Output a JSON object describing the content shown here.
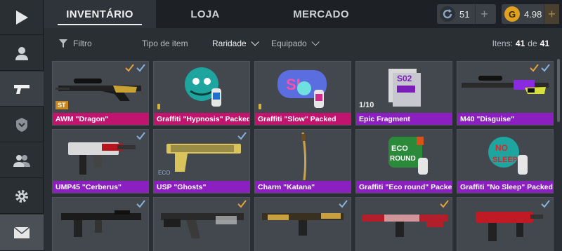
{
  "tabs": {
    "inventory": "INVENTÁRIO",
    "shop": "LOJA",
    "market": "MERCADO"
  },
  "currency": {
    "silver": {
      "value": "51",
      "icon": "refresh-coin-icon",
      "color": "#8aa4c4"
    },
    "gold": {
      "value": "4.98",
      "icon": "gold-coin-icon",
      "color": "#e0a020"
    }
  },
  "filters": {
    "filter": "Filtro",
    "item_type": "Tipo de item",
    "rarity": "Raridade",
    "equipped": "Equipado"
  },
  "items_count": {
    "label": "Itens:",
    "current": "41",
    "separator": "de",
    "total": "41"
  },
  "colors": {
    "pink": "#c0146e",
    "purple": "#7a1fb5",
    "dark_purple": "#8b1fc0",
    "check_orange": "#e3a33a",
    "check_blue": "#8ab0e0"
  },
  "items": [
    {
      "name": "AWM \"Dragon\"",
      "rarity": "pink",
      "badge": "ST",
      "checks": [
        "orange",
        "blue"
      ],
      "art": "sniper"
    },
    {
      "name": "Graffiti \"Hypnosis\" Packed",
      "rarity": "pink",
      "pin": true,
      "checks": [],
      "art": "graffiti-hypnosis"
    },
    {
      "name": "Graffiti \"Slow\" Packed",
      "rarity": "pink",
      "pin": true,
      "checks": [],
      "art": "graffiti-slow"
    },
    {
      "name": "Epic Fragment",
      "rarity": "purple",
      "count": "1/10",
      "checks": [],
      "art": "fragment"
    },
    {
      "name": "M40 \"Disguise\"",
      "rarity": "purple",
      "checks": [
        "orange",
        "blue"
      ],
      "art": "sniper-purple"
    },
    {
      "name": "UMP45 \"Cerberus\"",
      "rarity": "purple",
      "checks": [
        "blue"
      ],
      "art": "smg"
    },
    {
      "name": "USP \"Ghosts\"",
      "rarity": "purple",
      "checks": [
        "blue"
      ],
      "art": "pistol"
    },
    {
      "name": "Charm \"Katana\"",
      "rarity": "purple",
      "checks": [],
      "art": "katana"
    },
    {
      "name": "Graffiti \"Eco round\" Packed",
      "rarity": "purple",
      "checks": [],
      "art": "graffiti-eco"
    },
    {
      "name": "Graffiti \"No Sleep\" Packed",
      "rarity": "purple",
      "checks": [],
      "art": "graffiti-nosleep"
    },
    {
      "name": "",
      "rarity": "none",
      "checks": [
        "blue"
      ],
      "art": "rifle-black"
    },
    {
      "name": "",
      "rarity": "none",
      "checks": [
        "orange"
      ],
      "art": "ak"
    },
    {
      "name": "",
      "rarity": "none",
      "checks": [
        "blue"
      ],
      "art": "m4"
    },
    {
      "name": "",
      "rarity": "none",
      "checks": [
        "orange"
      ],
      "art": "rifle-red"
    },
    {
      "name": "",
      "rarity": "none",
      "checks": [
        "blue"
      ],
      "art": "smg-red"
    }
  ]
}
